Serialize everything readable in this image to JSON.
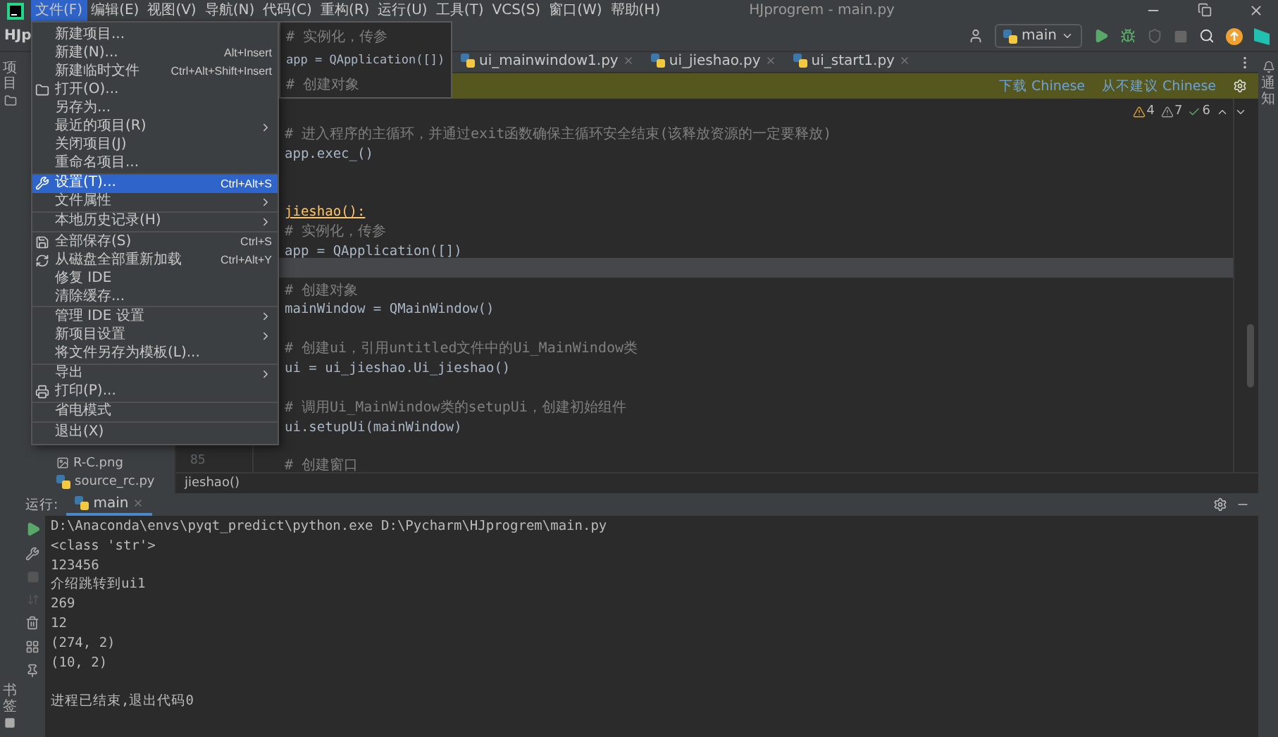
{
  "window": {
    "title": "HJprogrem - main.py"
  },
  "menu_bar": [
    {
      "label": "文件(F)",
      "selected": true
    },
    {
      "label": "编辑(E)",
      "selected": false
    },
    {
      "label": "视图(V)",
      "selected": false
    },
    {
      "label": "导航(N)",
      "selected": false
    },
    {
      "label": "代码(C)",
      "selected": false
    },
    {
      "label": "重构(R)",
      "selected": false
    },
    {
      "label": "运行(U)",
      "selected": false
    },
    {
      "label": "工具(T)",
      "selected": false
    },
    {
      "label": "VCS(S)",
      "selected": false
    },
    {
      "label": "窗口(W)",
      "selected": false
    },
    {
      "label": "帮助(H)",
      "selected": false
    }
  ],
  "file_menu": {
    "groups": [
      [
        {
          "label": "新建项目...",
          "kind": "plain",
          "selected": false
        },
        {
          "label": "新建(N)...",
          "shortcut": "Alt+Insert",
          "kind": "plain",
          "selected": false
        },
        {
          "label": "新建临时文件",
          "shortcut": "Ctrl+Alt+Shift+Insert",
          "kind": "plain",
          "selected": false
        },
        {
          "label": "打开(O)...",
          "kind": "open",
          "selected": false
        },
        {
          "label": "另存为...",
          "kind": "plain",
          "selected": false
        },
        {
          "label": "最近的项目(R)",
          "submenu": true,
          "kind": "plain",
          "selected": false
        },
        {
          "label": "关闭项目(J)",
          "kind": "plain",
          "selected": false
        },
        {
          "label": "重命名项目...",
          "kind": "plain",
          "selected": false
        }
      ],
      [
        {
          "label": "设置(T)...",
          "shortcut": "Ctrl+Alt+S",
          "kind": "settings",
          "selected": true
        },
        {
          "label": "文件属性",
          "submenu": true,
          "kind": "plain",
          "selected": false
        }
      ],
      [
        {
          "label": "本地历史记录(H)",
          "submenu": true,
          "kind": "plain",
          "selected": false
        }
      ],
      [
        {
          "label": "全部保存(S)",
          "shortcut": "Ctrl+S",
          "kind": "save",
          "selected": false
        },
        {
          "label": "从磁盘全部重新加载",
          "shortcut": "Ctrl+Alt+Y",
          "kind": "reload",
          "selected": false
        },
        {
          "label": "修复 IDE",
          "kind": "plain",
          "selected": false
        },
        {
          "label": "清除缓存...",
          "kind": "plain",
          "selected": false
        }
      ],
      [
        {
          "label": "管理 IDE 设置",
          "submenu": true,
          "kind": "plain",
          "selected": false
        },
        {
          "label": "新项目设置",
          "submenu": true,
          "kind": "plain",
          "selected": false
        },
        {
          "label": "将文件另存为模板(L)...",
          "kind": "plain",
          "selected": false
        }
      ],
      [
        {
          "label": "导出",
          "submenu": true,
          "kind": "plain",
          "selected": false
        },
        {
          "label": "打印(P)...",
          "kind": "print",
          "selected": false
        }
      ],
      [
        {
          "label": "省电模式",
          "kind": "plain",
          "selected": false
        }
      ],
      [
        {
          "label": "退出(X)",
          "kind": "plain",
          "selected": false
        }
      ]
    ]
  },
  "toolbar": {
    "project": "HJp",
    "run_config": "main"
  },
  "code_popup": {
    "lines": [
      {
        "text": "# 实例化，传参",
        "kind": "comment"
      },
      {
        "text": "app = QApplication([])",
        "kind": "code"
      },
      {
        "text": "# 创建对象",
        "kind": "comment"
      }
    ]
  },
  "editor_tabs": [
    {
      "label": "ui_mainwindow1.py",
      "selected": false
    },
    {
      "label": "ui_jieshao.py",
      "selected": false
    },
    {
      "label": "ui_start1.py",
      "selected": false
    }
  ],
  "notice": {
    "links": [
      "下载 Chinese",
      "从不建议 Chinese"
    ]
  },
  "inspections": {
    "warnings": "4",
    "weak_warnings": "7",
    "typos": "6"
  },
  "project_tree": [
    {
      "label": "R-C.png",
      "kind": "image"
    },
    {
      "label": "source_rc.py",
      "kind": "python"
    }
  ],
  "code": [
    {
      "kind": "blank",
      "current": false
    },
    {
      "kind": "comment",
      "text": "# 进入程序的主循环，并通过exit函数确保主循环安全结束(该释放资源的一定要释放)",
      "current": false
    },
    {
      "kind": "code",
      "text": "app.exec_()",
      "current": false
    },
    {
      "kind": "blank",
      "current": false
    },
    {
      "kind": "blank",
      "current": false
    },
    {
      "kind": "def",
      "text": "jieshao():",
      "current": false
    },
    {
      "kind": "comment",
      "text": "# 实例化，传参",
      "current": false
    },
    {
      "kind": "code",
      "text": "app = QApplication([])",
      "current": false
    },
    {
      "kind": "blank",
      "current": true
    },
    {
      "kind": "comment",
      "text": "# 创建对象",
      "current": false
    },
    {
      "kind": "code",
      "text": "mainWindow = QMainWindow()",
      "current": false
    },
    {
      "kind": "blank",
      "current": false
    },
    {
      "kind": "comment",
      "text": "# 创建ui，引用untitled文件中的Ui_MainWindow类",
      "current": false
    },
    {
      "kind": "code",
      "text": "ui = ui_jieshao.Ui_jieshao()",
      "current": false
    },
    {
      "kind": "blank",
      "current": false
    },
    {
      "kind": "comment",
      "text": "# 调用Ui_MainWindow类的setupUi，创建初始组件",
      "current": false
    },
    {
      "kind": "code",
      "text": "ui.setupUi(mainWindow)",
      "current": false
    },
    {
      "kind": "blank",
      "current": false
    },
    {
      "kind": "comment",
      "text": "# 创建窗口",
      "number": "85",
      "current": false
    }
  ],
  "breadcrumb": "jieshao()",
  "side_labels": {
    "left_top": "项目",
    "left_bottom": "书签",
    "right_top": "通知"
  },
  "run_panel": {
    "label": "运行:",
    "tab": "main",
    "lines": [
      {
        "text": "D:\\Anaconda\\envs\\pyqt_predict\\python.exe D:\\Pycharm\\HJprogrem\\main.py"
      },
      {
        "text": "<class 'str'>"
      },
      {
        "text": "123456"
      },
      {
        "text": "介绍跳转到ui1"
      },
      {
        "text": "269"
      },
      {
        "text": "12"
      },
      {
        "text": "(274, 2)"
      },
      {
        "text": "(10, 2)"
      },
      {
        "text": "进程已结束,退出代码0",
        "gap_before": true
      }
    ]
  }
}
